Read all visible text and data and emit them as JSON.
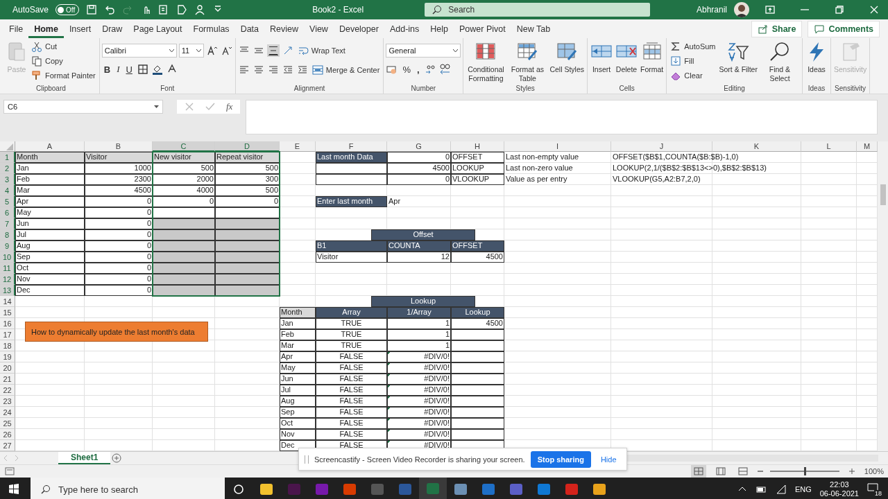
{
  "title_bar": {
    "autosave_label": "AutoSave",
    "autosave": {
      "label": "Off",
      "on": false
    },
    "title": "Book2  -  Excel",
    "search": {
      "placeholder": "Search"
    },
    "user": "Abhranil"
  },
  "tabs": [
    {
      "label": "File",
      "selected": false
    },
    {
      "label": "Home",
      "selected": true
    },
    {
      "label": "Insert",
      "selected": false
    },
    {
      "label": "Draw",
      "selected": false
    },
    {
      "label": "Page Layout",
      "selected": false
    },
    {
      "label": "Formulas",
      "selected": false
    },
    {
      "label": "Data",
      "selected": false
    },
    {
      "label": "Review",
      "selected": false
    },
    {
      "label": "View",
      "selected": false
    },
    {
      "label": "Developer",
      "selected": false
    },
    {
      "label": "Add-ins",
      "selected": false
    },
    {
      "label": "Help",
      "selected": false
    },
    {
      "label": "Power Pivot",
      "selected": false
    },
    {
      "label": "New Tab",
      "selected": false
    }
  ],
  "share": "Share",
  "comments": "Comments",
  "ribbon": [
    {
      "label": "Clipboard",
      "kind": "stacks",
      "stacks": [
        [
          {
            "kind": "large",
            "label": "Paste",
            "disabled": true
          }
        ],
        [
          {
            "kind": "small",
            "label": "Cut"
          },
          {
            "kind": "small",
            "label": "Copy"
          },
          {
            "kind": "small",
            "label": "Format Painter"
          }
        ]
      ]
    },
    {
      "label": "Font",
      "kind": "lines",
      "top": [
        {
          "kind": "field",
          "value": "Calibri"
        },
        {
          "kind": "field",
          "value": "11"
        },
        {
          "kind": "icon"
        },
        {
          "kind": "icon"
        }
      ],
      "bottom": [
        {
          "kind": "bold-glyph",
          "label": "B"
        },
        {
          "kind": "italic-glyph",
          "label": "I"
        },
        {
          "kind": "underline-glyph",
          "label": "U"
        },
        {
          "kind": "icon"
        },
        {
          "kind": "icon"
        },
        {
          "kind": "icon"
        }
      ]
    },
    {
      "label": "Alignment",
      "kind": "lines",
      "top": [
        {
          "kind": "icon",
          "selected": false
        },
        {
          "kind": "icon",
          "selected": false
        },
        {
          "kind": "icon",
          "selected": true
        },
        {
          "kind": "icon"
        },
        {
          "kind": "small",
          "label": "Wrap Text"
        }
      ],
      "bottom": [
        {
          "kind": "icon",
          "selected": false
        },
        {
          "kind": "icon",
          "selected": false
        },
        {
          "kind": "icon",
          "selected": false
        },
        {
          "kind": "icon"
        },
        {
          "kind": "icon"
        },
        {
          "kind": "small",
          "label": "Merge & Center"
        }
      ]
    },
    {
      "label": "Number",
      "kind": "lines",
      "top": [
        {
          "kind": "field",
          "value": "General"
        }
      ],
      "bottom": [
        {
          "kind": "icon"
        },
        {
          "kind": "percent-glyph",
          "label": "%"
        },
        {
          "kind": "comma-glyph",
          "label": ","
        },
        {
          "kind": "icon"
        },
        {
          "kind": "icon"
        }
      ]
    },
    {
      "label": "Styles",
      "kind": "stacks",
      "stacks": [
        [
          {
            "kind": "large",
            "label": "Conditional Formatting",
            "disabled": false
          }
        ],
        [
          {
            "kind": "large",
            "label": "Format as Table",
            "disabled": false
          }
        ],
        [
          {
            "kind": "large",
            "label": "Cell Styles",
            "disabled": false
          }
        ]
      ]
    },
    {
      "label": "Cells",
      "kind": "stacks",
      "stacks": [
        [
          {
            "kind": "large",
            "label": "Insert",
            "disabled": false
          }
        ],
        [
          {
            "kind": "large",
            "label": "Delete",
            "disabled": false
          }
        ],
        [
          {
            "kind": "large",
            "label": "Format",
            "disabled": false
          }
        ]
      ]
    },
    {
      "label": "Editing",
      "kind": "stacks",
      "stacks": [
        [
          {
            "kind": "small",
            "label": "AutoSum"
          },
          {
            "kind": "small",
            "label": "Fill"
          },
          {
            "kind": "small",
            "label": "Clear"
          }
        ],
        [
          {
            "kind": "large",
            "label": "Sort & Filter",
            "disabled": false
          }
        ],
        [
          {
            "kind": "large",
            "label": "Find & Select",
            "disabled": false
          }
        ]
      ]
    },
    {
      "label": "Ideas",
      "kind": "stacks",
      "stacks": [
        [
          {
            "kind": "large",
            "label": "Ideas",
            "disabled": false
          }
        ]
      ]
    },
    {
      "label": "Sensitivity",
      "kind": "stacks",
      "stacks": [
        [
          {
            "kind": "large",
            "label": "Sensitivity",
            "disabled": true
          }
        ]
      ]
    }
  ],
  "formula_bar": {
    "name_box": "C6",
    "function_label": "fx"
  },
  "grid": {
    "columns": [
      {
        "label": "A",
        "selected": false
      },
      {
        "label": "B",
        "selected": false
      },
      {
        "label": "C",
        "selected": true
      },
      {
        "label": "D",
        "selected": true
      },
      {
        "label": "E",
        "selected": false
      },
      {
        "label": "F",
        "selected": false
      },
      {
        "label": "G",
        "selected": false
      },
      {
        "label": "H",
        "selected": false
      },
      {
        "label": "I",
        "selected": false
      },
      {
        "label": "J",
        "selected": false
      },
      {
        "label": "K",
        "selected": false
      },
      {
        "label": "L",
        "selected": false
      },
      {
        "label": "M",
        "selected": false
      }
    ],
    "rows": [
      {
        "number": "1",
        "selected": true,
        "cells": [
          {
            "kind": "head",
            "text": "Month"
          },
          {
            "kind": "head",
            "text": "Visitor"
          },
          {
            "kind": "head",
            "text": "New visitor"
          },
          {
            "kind": "head",
            "text": "Repeat visitor"
          },
          {
            "kind": "empty"
          },
          {
            "kind": "dark",
            "text": "Last month Data"
          },
          {
            "kind": "number",
            "text": "0"
          },
          {
            "kind": "text",
            "text": "OFFSET"
          },
          {
            "kind": "plain",
            "text": "Last non-empty value"
          },
          {
            "kind": "plain",
            "text": "OFFSET($B$1,COUNTA($B:$B)-1,0)"
          }
        ]
      },
      {
        "number": "2",
        "selected": true,
        "cells": [
          {
            "kind": "text",
            "text": "Jan"
          },
          {
            "kind": "number",
            "text": "1000"
          },
          {
            "kind": "number",
            "text": "500"
          },
          {
            "kind": "number",
            "text": "500"
          },
          {
            "kind": "empty"
          },
          {
            "kind": "blank"
          },
          {
            "kind": "number",
            "text": "4500"
          },
          {
            "kind": "text",
            "text": "LOOKUP"
          },
          {
            "kind": "plain",
            "text": "Last non-zero value"
          },
          {
            "kind": "plain",
            "text": "LOOKUP(2,1/($B$2:$B$13<>0),$B$2:$B$13)"
          }
        ]
      },
      {
        "number": "3",
        "selected": true,
        "cells": [
          {
            "kind": "text",
            "text": "Feb"
          },
          {
            "kind": "number",
            "text": "2300"
          },
          {
            "kind": "number",
            "text": "2000"
          },
          {
            "kind": "number",
            "text": "300"
          },
          {
            "kind": "empty"
          },
          {
            "kind": "blank"
          },
          {
            "kind": "number",
            "text": "0"
          },
          {
            "kind": "text",
            "text": "VLOOKUP"
          },
          {
            "kind": "plain",
            "text": "Value as per entry"
          },
          {
            "kind": "plain",
            "text": "VLOOKUP(G5,A2:B7,2,0)"
          }
        ]
      },
      {
        "number": "4",
        "selected": true,
        "cells": [
          {
            "kind": "text",
            "text": "Mar"
          },
          {
            "kind": "number",
            "text": "4500"
          },
          {
            "kind": "number",
            "text": "4000"
          },
          {
            "kind": "number",
            "text": "500"
          }
        ]
      },
      {
        "number": "5",
        "selected": true,
        "cells": [
          {
            "kind": "text",
            "text": "Apr"
          },
          {
            "kind": "number",
            "text": "0"
          },
          {
            "kind": "number",
            "text": "0"
          },
          {
            "kind": "number",
            "text": "0"
          },
          {
            "kind": "empty"
          },
          {
            "kind": "dark",
            "text": "Enter last month"
          },
          {
            "kind": "plain",
            "text": "Apr"
          }
        ]
      },
      {
        "number": "6",
        "selected": true,
        "cells": [
          {
            "kind": "text",
            "text": "May"
          },
          {
            "kind": "number",
            "text": "0"
          },
          {
            "kind": "blank"
          },
          {
            "kind": "blank"
          }
        ]
      },
      {
        "number": "7",
        "selected": true,
        "cells": [
          {
            "kind": "text",
            "text": "Jun"
          },
          {
            "kind": "number",
            "text": "0"
          },
          {
            "kind": "shaded"
          },
          {
            "kind": "shaded"
          }
        ]
      },
      {
        "number": "8",
        "selected": true,
        "cells": [
          {
            "kind": "text",
            "text": "Jul"
          },
          {
            "kind": "number",
            "text": "0"
          },
          {
            "kind": "shaded"
          },
          {
            "kind": "shaded"
          },
          {
            "kind": "empty"
          },
          {
            "kind": "title",
            "text": "Offset"
          },
          {
            "kind": "merged"
          },
          {
            "kind": "merged"
          }
        ]
      },
      {
        "number": "9",
        "selected": true,
        "cells": [
          {
            "kind": "text",
            "text": "Aug"
          },
          {
            "kind": "number",
            "text": "0"
          },
          {
            "kind": "shaded"
          },
          {
            "kind": "shaded"
          },
          {
            "kind": "empty"
          },
          {
            "kind": "dark",
            "text": "B1"
          },
          {
            "kind": "dark",
            "text": "COUNTA"
          },
          {
            "kind": "dark",
            "text": "OFFSET"
          }
        ]
      },
      {
        "number": "10",
        "selected": true,
        "cells": [
          {
            "kind": "text",
            "text": "Sep"
          },
          {
            "kind": "number",
            "text": "0"
          },
          {
            "kind": "shaded"
          },
          {
            "kind": "shaded"
          },
          {
            "kind": "empty"
          },
          {
            "kind": "text",
            "text": "Visitor"
          },
          {
            "kind": "number",
            "text": "12"
          },
          {
            "kind": "number",
            "text": "4500"
          }
        ]
      },
      {
        "number": "11",
        "selected": true,
        "cells": [
          {
            "kind": "text",
            "text": "Oct"
          },
          {
            "kind": "number",
            "text": "0"
          },
          {
            "kind": "shaded"
          },
          {
            "kind": "shaded"
          }
        ]
      },
      {
        "number": "12",
        "selected": true,
        "cells": [
          {
            "kind": "text",
            "text": "Nov"
          },
          {
            "kind": "number",
            "text": "0"
          },
          {
            "kind": "shaded"
          },
          {
            "kind": "shaded"
          }
        ]
      },
      {
        "number": "13",
        "selected": true,
        "cells": [
          {
            "kind": "text",
            "text": "Dec"
          },
          {
            "kind": "number",
            "text": "0"
          },
          {
            "kind": "shaded"
          },
          {
            "kind": "shaded"
          }
        ]
      },
      {
        "number": "14",
        "selected": false,
        "cells": [
          {
            "kind": "empty"
          },
          {
            "kind": "empty"
          },
          {
            "kind": "empty"
          },
          {
            "kind": "empty"
          },
          {
            "kind": "empty"
          },
          {
            "kind": "title",
            "text": "Lookup"
          },
          {
            "kind": "merged"
          },
          {
            "kind": "merged"
          }
        ]
      },
      {
        "number": "15",
        "selected": false,
        "cells": [
          {
            "kind": "empty"
          },
          {
            "kind": "empty"
          },
          {
            "kind": "empty"
          },
          {
            "kind": "empty"
          },
          {
            "kind": "head",
            "text": "Month"
          },
          {
            "kind": "dark-center",
            "text": "Array"
          },
          {
            "kind": "dark-center",
            "text": "1/Array"
          },
          {
            "kind": "dark-center",
            "text": "Lookup"
          }
        ]
      },
      {
        "number": "16",
        "selected": false,
        "cells": [
          {
            "kind": "empty"
          },
          {
            "kind": "empty"
          },
          {
            "kind": "empty"
          },
          {
            "kind": "empty"
          },
          {
            "kind": "text",
            "text": "Jan"
          },
          {
            "kind": "logical",
            "text": "TRUE"
          },
          {
            "kind": "number",
            "text": "1"
          },
          {
            "kind": "number",
            "text": "4500"
          }
        ]
      },
      {
        "number": "17",
        "selected": false,
        "cells": [
          {
            "kind": "empty"
          },
          {
            "kind": "empty"
          },
          {
            "kind": "empty"
          },
          {
            "kind": "empty"
          },
          {
            "kind": "text",
            "text": "Feb"
          },
          {
            "kind": "logical",
            "text": "TRUE"
          },
          {
            "kind": "number",
            "text": "1"
          },
          {
            "kind": "blank"
          }
        ]
      },
      {
        "number": "18",
        "selected": false,
        "cells": [
          {
            "kind": "empty"
          },
          {
            "kind": "empty"
          },
          {
            "kind": "empty"
          },
          {
            "kind": "empty"
          },
          {
            "kind": "text",
            "text": "Mar"
          },
          {
            "kind": "logical",
            "text": "TRUE"
          },
          {
            "kind": "number",
            "text": "1"
          },
          {
            "kind": "blank"
          }
        ]
      },
      {
        "number": "19",
        "selected": false,
        "cells": [
          {
            "kind": "empty"
          },
          {
            "kind": "empty"
          },
          {
            "kind": "empty"
          },
          {
            "kind": "empty"
          },
          {
            "kind": "text",
            "text": "Apr"
          },
          {
            "kind": "logical",
            "text": "FALSE"
          },
          {
            "kind": "error",
            "text": "#DIV/0!"
          },
          {
            "kind": "blank"
          }
        ]
      },
      {
        "number": "20",
        "selected": false,
        "cells": [
          {
            "kind": "empty"
          },
          {
            "kind": "empty"
          },
          {
            "kind": "empty"
          },
          {
            "kind": "empty"
          },
          {
            "kind": "text",
            "text": "May"
          },
          {
            "kind": "logical",
            "text": "FALSE"
          },
          {
            "kind": "error",
            "text": "#DIV/0!"
          },
          {
            "kind": "blank"
          }
        ]
      },
      {
        "number": "21",
        "selected": false,
        "cells": [
          {
            "kind": "empty"
          },
          {
            "kind": "empty"
          },
          {
            "kind": "empty"
          },
          {
            "kind": "empty"
          },
          {
            "kind": "text",
            "text": "Jun"
          },
          {
            "kind": "logical",
            "text": "FALSE"
          },
          {
            "kind": "error",
            "text": "#DIV/0!"
          },
          {
            "kind": "blank"
          }
        ]
      },
      {
        "number": "22",
        "selected": false,
        "cells": [
          {
            "kind": "empty"
          },
          {
            "kind": "empty"
          },
          {
            "kind": "empty"
          },
          {
            "kind": "empty"
          },
          {
            "kind": "text",
            "text": "Jul"
          },
          {
            "kind": "logical",
            "text": "FALSE"
          },
          {
            "kind": "error",
            "text": "#DIV/0!"
          },
          {
            "kind": "blank"
          }
        ]
      },
      {
        "number": "23",
        "selected": false,
        "cells": [
          {
            "kind": "empty"
          },
          {
            "kind": "empty"
          },
          {
            "kind": "empty"
          },
          {
            "kind": "empty"
          },
          {
            "kind": "text",
            "text": "Aug"
          },
          {
            "kind": "logical",
            "text": "FALSE"
          },
          {
            "kind": "error",
            "text": "#DIV/0!"
          },
          {
            "kind": "blank"
          }
        ]
      },
      {
        "number": "24",
        "selected": false,
        "cells": [
          {
            "kind": "empty"
          },
          {
            "kind": "empty"
          },
          {
            "kind": "empty"
          },
          {
            "kind": "empty"
          },
          {
            "kind": "text",
            "text": "Sep"
          },
          {
            "kind": "logical",
            "text": "FALSE"
          },
          {
            "kind": "error",
            "text": "#DIV/0!"
          },
          {
            "kind": "blank"
          }
        ]
      },
      {
        "number": "25",
        "selected": false,
        "cells": [
          {
            "kind": "empty"
          },
          {
            "kind": "empty"
          },
          {
            "kind": "empty"
          },
          {
            "kind": "empty"
          },
          {
            "kind": "text",
            "text": "Oct"
          },
          {
            "kind": "logical",
            "text": "FALSE"
          },
          {
            "kind": "error",
            "text": "#DIV/0!"
          },
          {
            "kind": "blank"
          }
        ]
      },
      {
        "number": "26",
        "selected": false,
        "cells": [
          {
            "kind": "empty"
          },
          {
            "kind": "empty"
          },
          {
            "kind": "empty"
          },
          {
            "kind": "empty"
          },
          {
            "kind": "text",
            "text": "Nov"
          },
          {
            "kind": "logical",
            "text": "FALSE"
          },
          {
            "kind": "error",
            "text": "#DIV/0!"
          },
          {
            "kind": "blank"
          }
        ]
      },
      {
        "number": "27",
        "selected": false,
        "cells": [
          {
            "kind": "empty"
          },
          {
            "kind": "empty"
          },
          {
            "kind": "empty"
          },
          {
            "kind": "empty"
          },
          {
            "kind": "text",
            "text": "Dec"
          },
          {
            "kind": "logical",
            "text": "FALSE"
          },
          {
            "kind": "error",
            "text": "#DIV/0!"
          },
          {
            "kind": "blank"
          }
        ]
      }
    ],
    "shape": {
      "text": "How to dynamically update the last month's data"
    }
  },
  "sheet_bar": {
    "sheets": [
      {
        "label": "Sheet1",
        "selected": true
      }
    ]
  },
  "notification": {
    "message": "Screencastify - Screen Video Recorder is sharing your screen.",
    "action": "Stop sharing",
    "dismiss": "Hide"
  },
  "status_bar": {
    "views": [
      {
        "selected": true
      },
      {
        "selected": false
      },
      {
        "selected": false
      }
    ],
    "zoom": {
      "level": 0.5,
      "label": "100%"
    }
  },
  "taskbar": {
    "search": {
      "placeholder": "Type here to search"
    },
    "apps": [
      {
        "color": "#f2c12e",
        "selected": false
      },
      {
        "color": "#4a154b",
        "selected": false
      },
      {
        "color": "#7719aa",
        "selected": false
      },
      {
        "color": "#d83b01",
        "selected": false
      },
      {
        "color": "#555555",
        "selected": false
      },
      {
        "color": "#2b579a",
        "selected": false
      },
      {
        "color": "#217346",
        "selected": true
      },
      {
        "color": "#6b8fb3",
        "selected": false
      },
      {
        "color": "#1e6fc7",
        "selected": false
      },
      {
        "color": "#5b5fc7",
        "selected": false
      },
      {
        "color": "#0f78d4",
        "selected": false
      },
      {
        "color": "#d4231b",
        "selected": false
      },
      {
        "color": "#e8a21b",
        "selected": false
      }
    ],
    "language": "ENG",
    "time": "22:03",
    "date": "06-06-2021",
    "notifications": "18"
  }
}
